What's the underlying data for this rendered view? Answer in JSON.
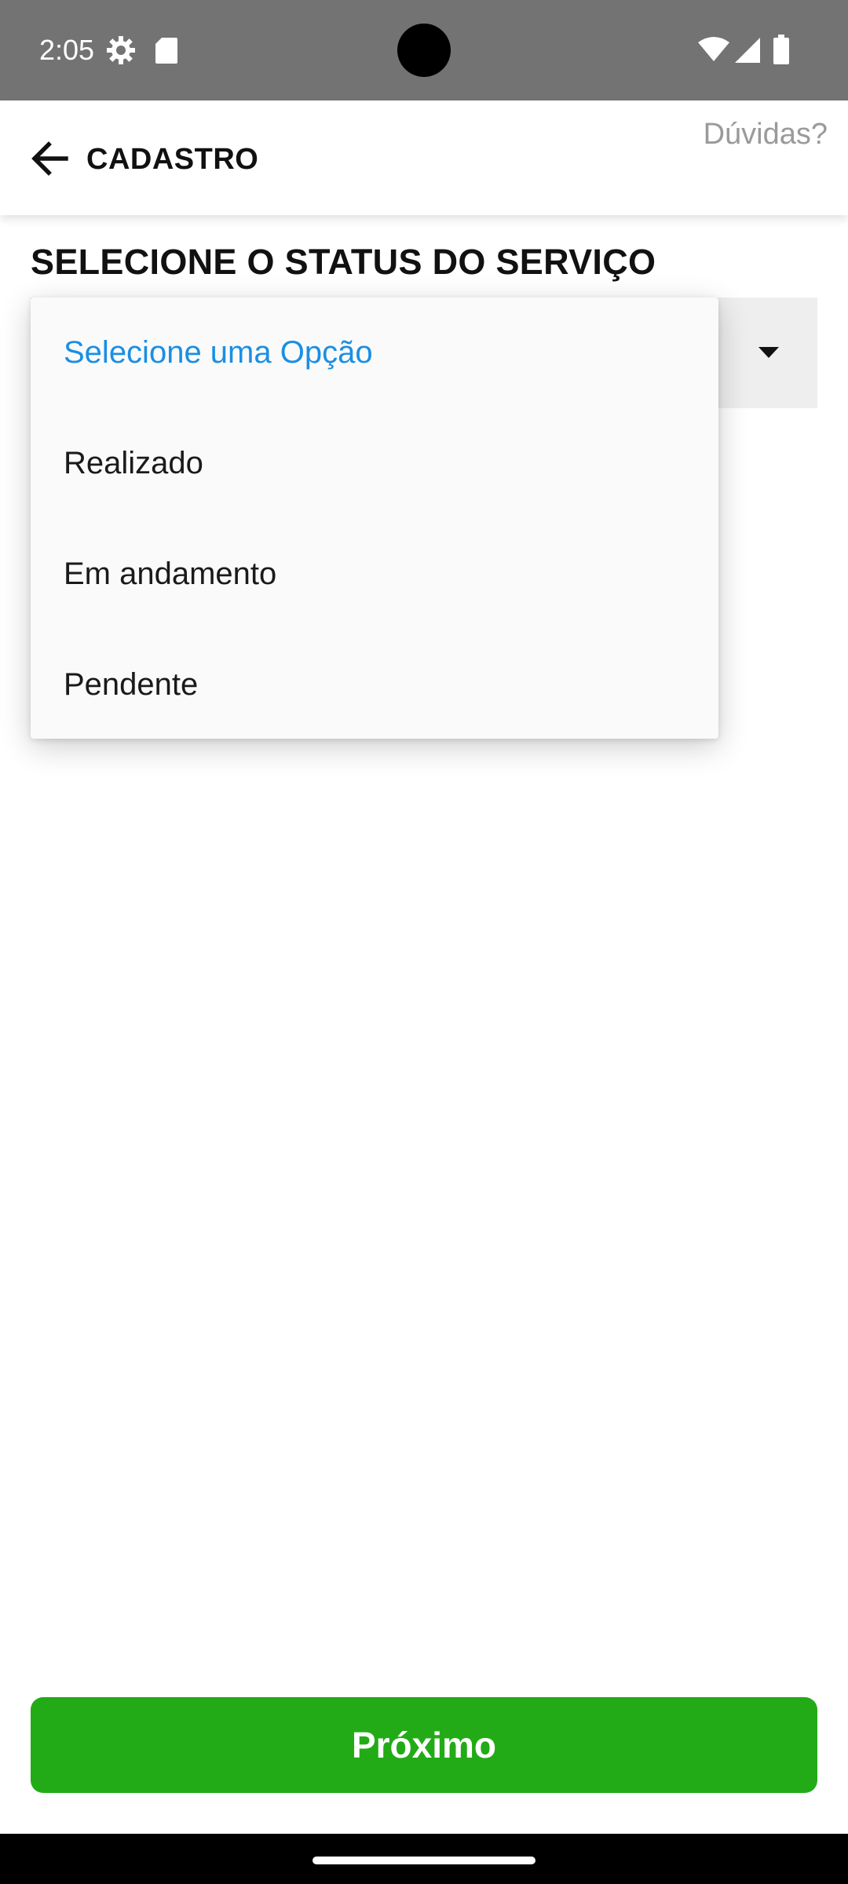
{
  "status_bar": {
    "time": "2:05",
    "icons": [
      "gear-icon",
      "sd-card-icon",
      "wifi-icon",
      "signal-icon",
      "battery-icon"
    ]
  },
  "app_bar": {
    "back_icon": "arrow-left-icon",
    "title": "CADASTRO",
    "help_label": "Dúvidas?"
  },
  "main": {
    "heading": "SELECIONE O STATUS DO SERVIÇO",
    "select": {
      "caret_icon": "caret-down-icon",
      "options": [
        {
          "label": "Selecione uma Opção",
          "selected": true
        },
        {
          "label": "Realizado",
          "selected": false
        },
        {
          "label": "Em andamento",
          "selected": false
        },
        {
          "label": "Pendente",
          "selected": false
        }
      ]
    }
  },
  "footer": {
    "next_label": "Próximo"
  },
  "colors": {
    "status_bar": "#737373",
    "accent_blue": "#1a8fe3",
    "button_green": "#22ab17",
    "help_gray": "#9a9a9a"
  }
}
